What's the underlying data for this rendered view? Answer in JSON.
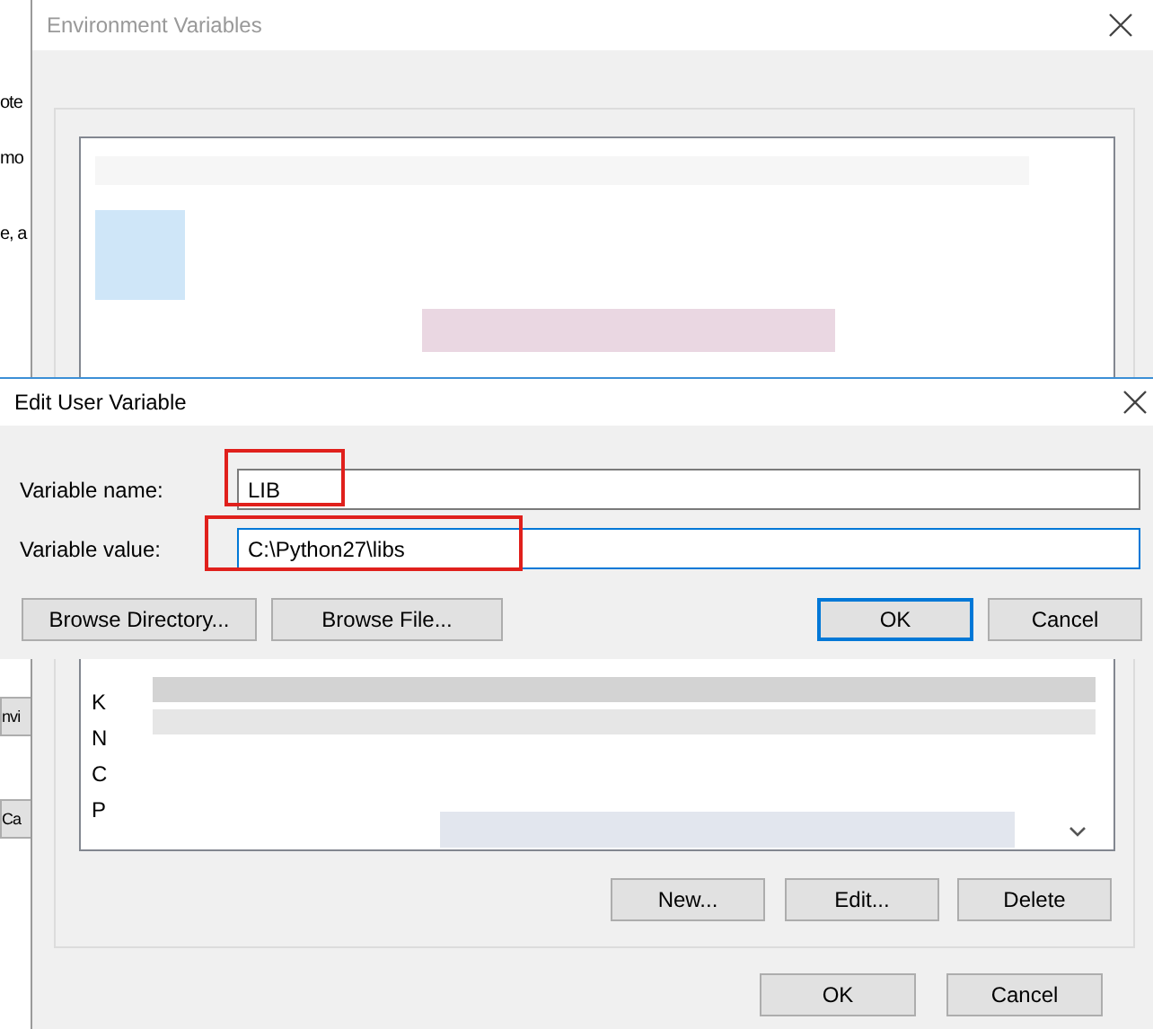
{
  "back_window": {
    "fragments": [
      "ote",
      "mo",
      "e, a"
    ],
    "buttons": [
      "nvi",
      "Ca"
    ]
  },
  "environment_variables": {
    "title": "Environment Variables",
    "list_rows": [
      "K",
      "N",
      "C",
      "P"
    ],
    "buttons": [
      "New...",
      "Edit...",
      "Delete"
    ],
    "footer_buttons": [
      "OK",
      "Cancel"
    ]
  },
  "edit_dialog": {
    "title": "Edit User Variable",
    "fields": [
      {
        "label": "Variable name:",
        "value": "LIB",
        "focused": false
      },
      {
        "label": "Variable value:",
        "value": "C:\\Python27\\libs",
        "focused": true
      }
    ],
    "buttons": [
      {
        "label": "Browse Directory...",
        "default": false
      },
      {
        "label": "Browse File...",
        "default": false
      },
      {
        "label": "OK",
        "default": true
      },
      {
        "label": "Cancel",
        "default": false
      }
    ]
  }
}
